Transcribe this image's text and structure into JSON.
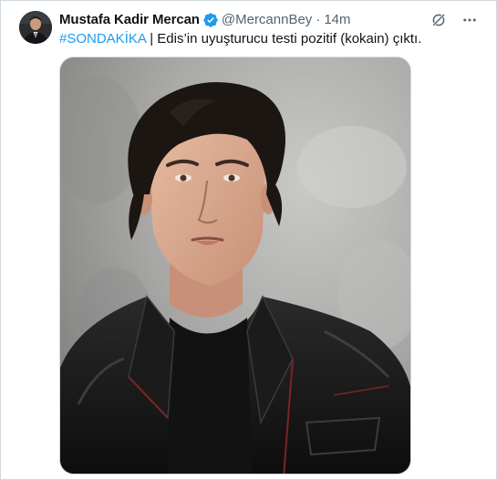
{
  "tweet": {
    "author": {
      "display_name": "Mustafa Kadir Mercan",
      "handle": "@MercannBey",
      "avatar_icon": "profile-photo",
      "verified": true,
      "verified_color": "#1d9bf0"
    },
    "separator": "·",
    "timestamp": "14m",
    "text": {
      "hashtag": "#SONDAKİKA",
      "body": " | Edis’in uyuşturucu testi pozitif (kokain) çıktı."
    },
    "media": {
      "type": "photo",
      "icon": "portrait-photo"
    },
    "actions": [
      {
        "name": "grok-icon"
      },
      {
        "name": "more-options-icon"
      }
    ]
  },
  "colors": {
    "text_primary": "#0f1419",
    "text_secondary": "#536471",
    "accent": "#1d9bf0",
    "border": "#cfd9de"
  }
}
